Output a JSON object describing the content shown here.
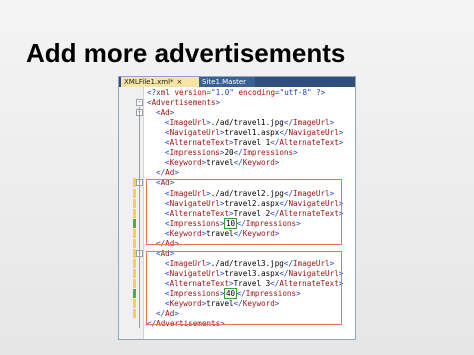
{
  "slide": {
    "title": "Add more advertisements"
  },
  "tabs": [
    {
      "label": "XMLFile1.xml*",
      "close": "×"
    },
    {
      "label": "Site1.Master",
      "close": ""
    }
  ],
  "code": {
    "decl_prefix": "<?",
    "decl_name": "xml",
    "decl_attr1": " version",
    "decl_eq": "=",
    "decl_val1": "\"1.0\"",
    "decl_attr2": " encoding",
    "decl_val2": "\"utf-8\"",
    "decl_suffix": " ?>",
    "root_open": "Advertisements",
    "root_close": "Advertisements",
    "ad_tag": "Ad",
    "t_image": "ImageUrl",
    "t_nav": "NavigateUrl",
    "t_alt": "AlternateText",
    "t_imp": "Impressions",
    "t_key": "Keyword",
    "lt": "<",
    "gt": ">",
    "lts": "</",
    "ads": [
      {
        "image": "./ad/travel1.jpg",
        "nav": "travel1.aspx",
        "alt": "Travel 1",
        "imp": "20",
        "key": "travel"
      },
      {
        "image": "./ad/travel2.jpg",
        "nav": "travel2.aspx",
        "alt": "Travel 2",
        "imp": "10",
        "key": "travel"
      },
      {
        "image": "./ad/travel3.jpg",
        "nav": "travel3.aspx",
        "alt": "Travel 3",
        "imp": "40",
        "key": "travel"
      }
    ]
  }
}
